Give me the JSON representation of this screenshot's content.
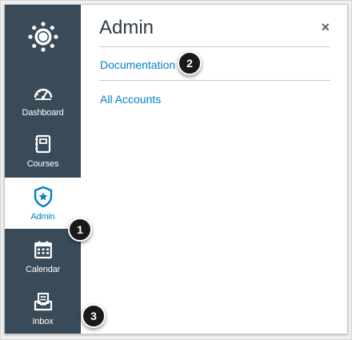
{
  "nav": {
    "logo_icon": "canvas-logo-icon",
    "items": [
      {
        "label": "Dashboard",
        "icon": "dashboard-gauge-icon",
        "active": false
      },
      {
        "label": "Courses",
        "icon": "courses-book-icon",
        "active": false
      },
      {
        "label": "Admin",
        "icon": "admin-shield-icon",
        "active": true
      },
      {
        "label": "Calendar",
        "icon": "calendar-icon",
        "active": false
      },
      {
        "label": "Inbox",
        "icon": "inbox-icon",
        "active": false
      }
    ]
  },
  "tray": {
    "title": "Admin",
    "close_symbol": "×",
    "links": [
      {
        "label": "Documentation"
      },
      {
        "label": "All Accounts"
      }
    ]
  },
  "callouts": [
    "1",
    "2",
    "3"
  ],
  "colors": {
    "nav_bg": "#394b58",
    "active_text": "#0081c7",
    "link": "#0081c7",
    "title": "#2d3b45",
    "badge": "#1a1a1a"
  }
}
